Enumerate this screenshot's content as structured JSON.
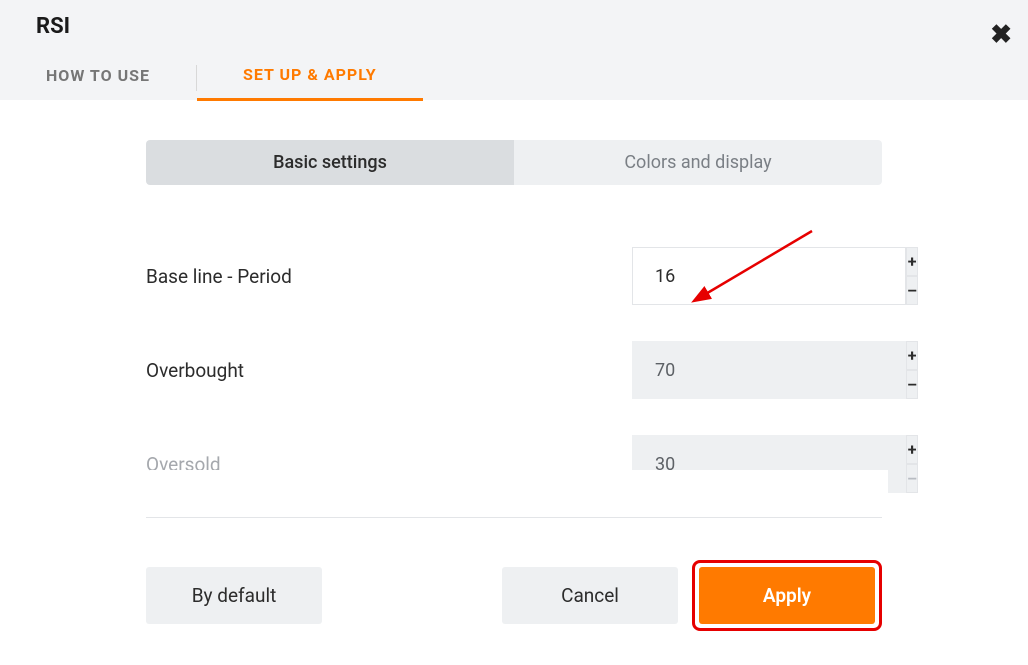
{
  "header": {
    "title": "RSI"
  },
  "tabs": {
    "how_to_use": "HOW TO USE",
    "setup_apply": "SET UP & APPLY"
  },
  "segmented": {
    "basic": "Basic settings",
    "colors": "Colors and display"
  },
  "fields": {
    "baseline": {
      "label": "Base line - Period",
      "value": "16"
    },
    "overbought": {
      "label": "Overbought",
      "value": "70"
    },
    "oversold": {
      "label": "Oversold",
      "value": "30"
    }
  },
  "actions": {
    "default": "By default",
    "cancel": "Cancel",
    "apply": "Apply"
  },
  "colors": {
    "accent": "#ff7a00",
    "highlight": "#e60000"
  }
}
